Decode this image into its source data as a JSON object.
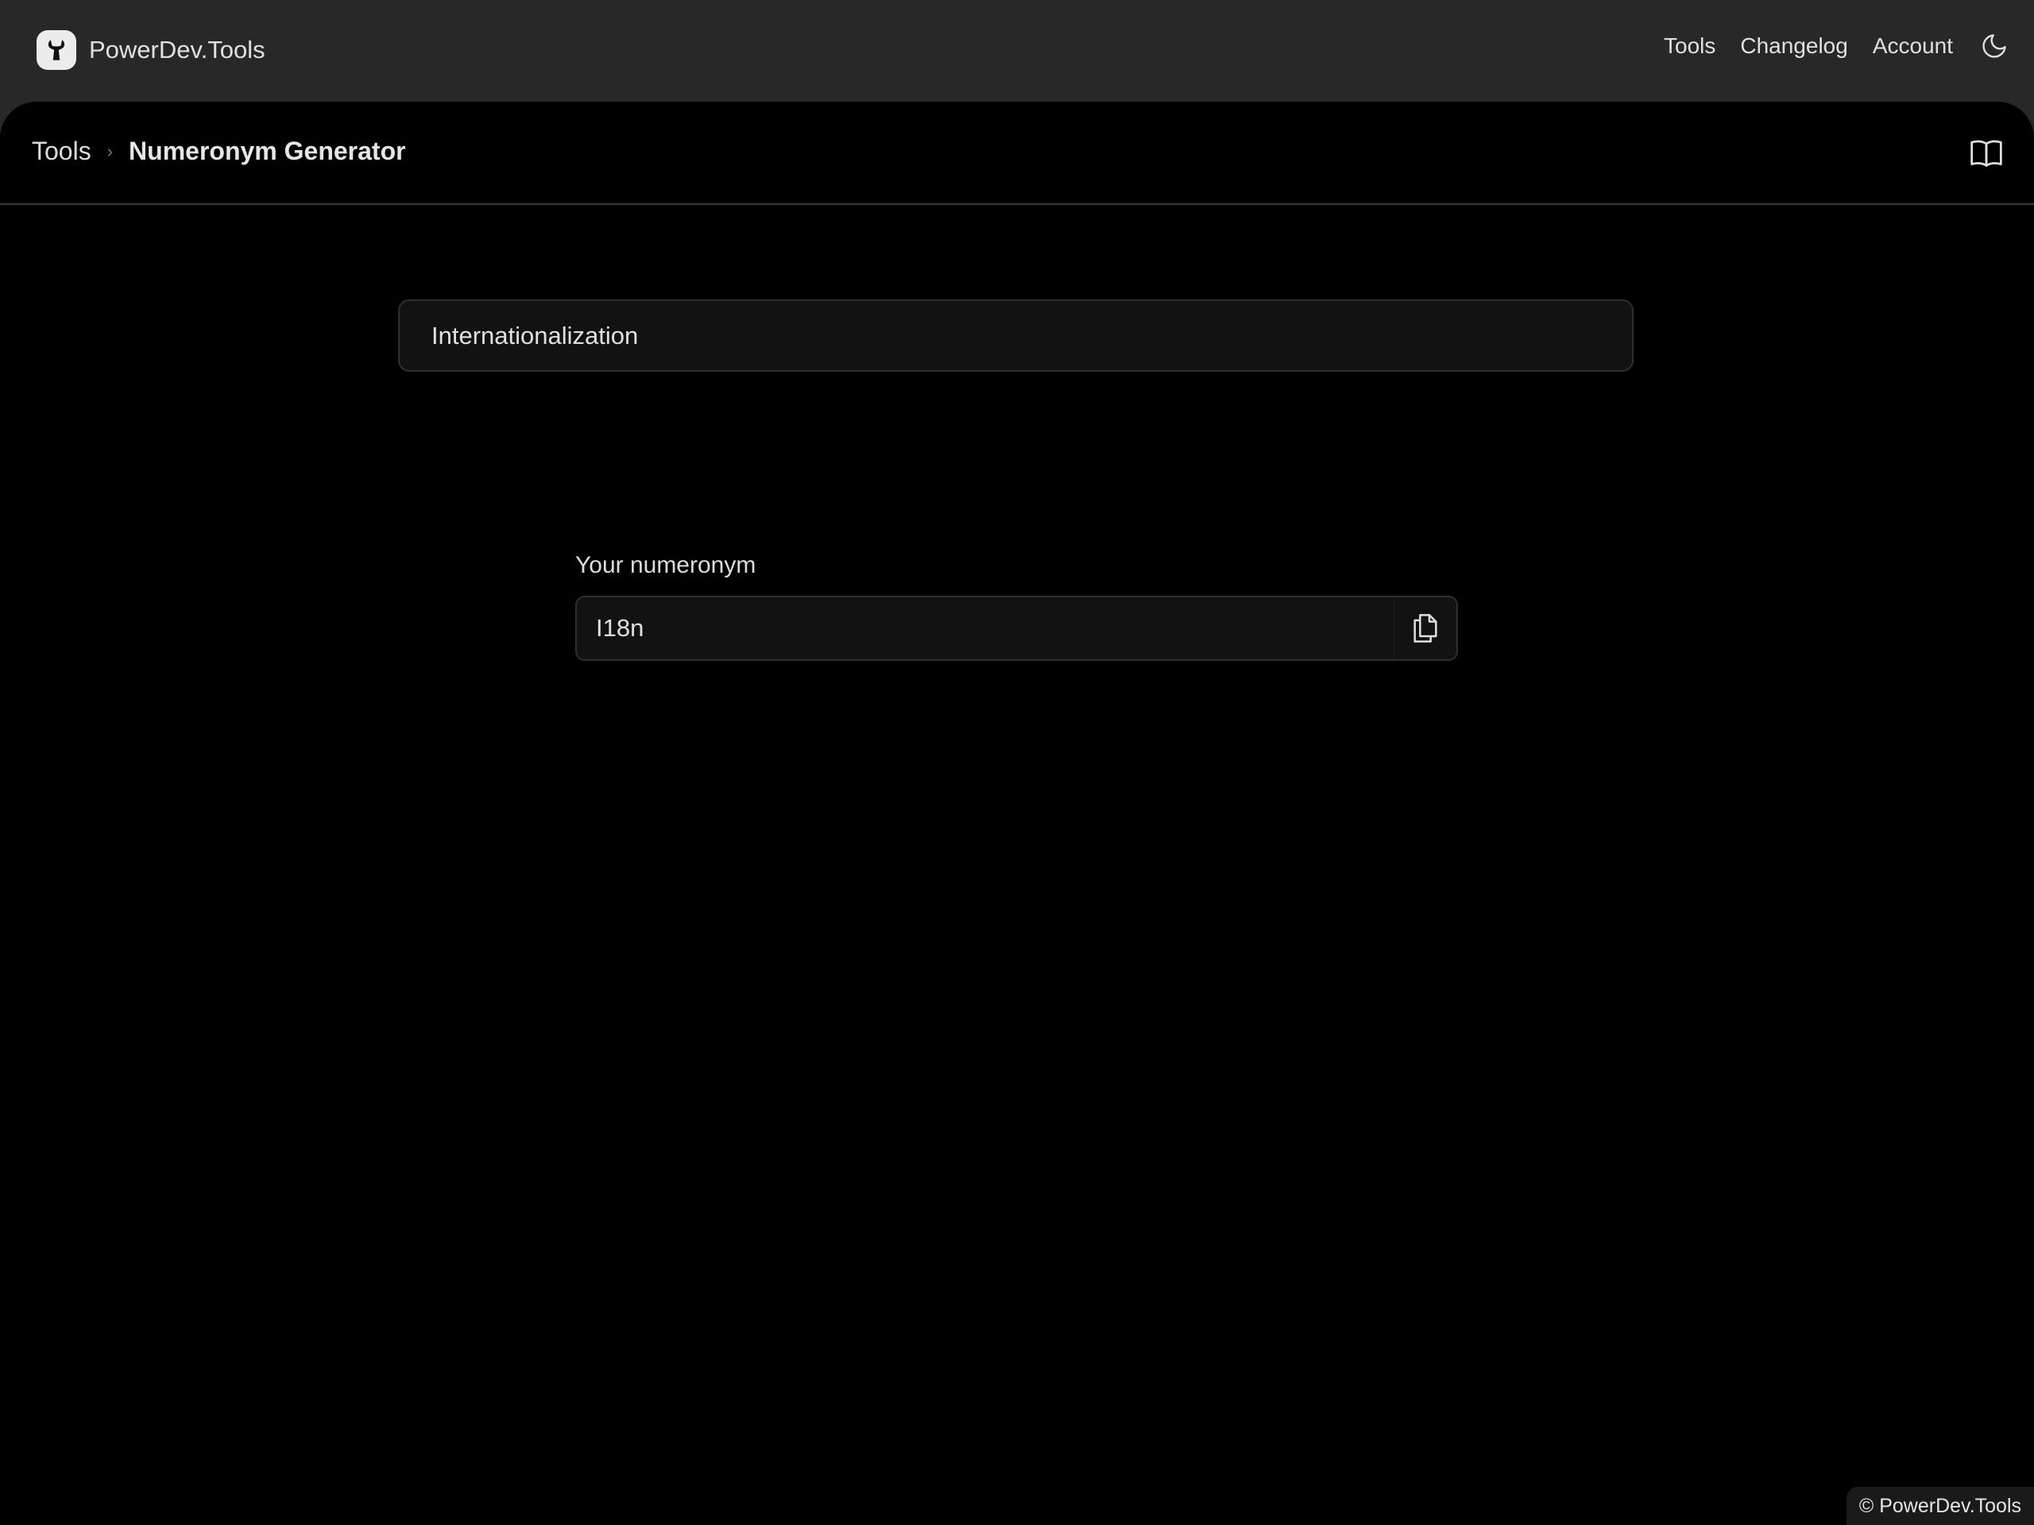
{
  "header": {
    "brand": "PowerDev.Tools",
    "logo_icon": "wrench-icon",
    "nav": [
      "Tools",
      "Changelog",
      "Account"
    ],
    "theme_icon": "moon-icon"
  },
  "breadcrumb": {
    "parent": "Tools",
    "separator_icon": "chevron-right-icon",
    "current": "Numeronym Generator",
    "docs_icon": "book-open-icon"
  },
  "tool": {
    "input_value": "Internationalization",
    "output_label": "Your numeronym",
    "output_value": "I18n",
    "copy_icon": "copy-icon"
  },
  "footer": {
    "text": "© PowerDev.Tools"
  }
}
